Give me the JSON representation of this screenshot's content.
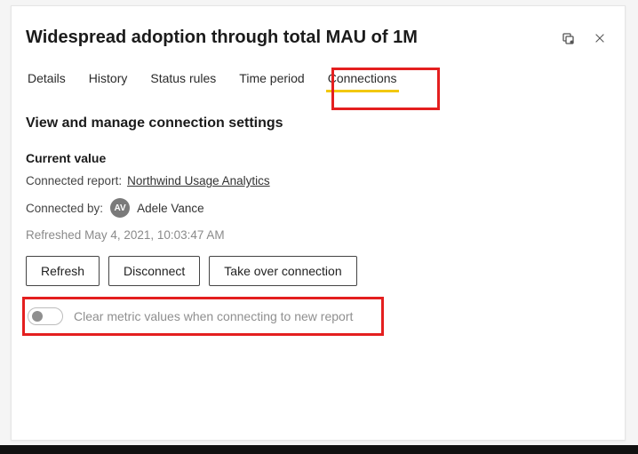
{
  "header": {
    "title": "Widespread adoption through total MAU of 1M"
  },
  "tabs": {
    "items": [
      {
        "label": "Details"
      },
      {
        "label": "History"
      },
      {
        "label": "Status rules"
      },
      {
        "label": "Time period"
      },
      {
        "label": "Connections"
      }
    ]
  },
  "section": {
    "title": "View and manage connection settings",
    "currentValueTitle": "Current value",
    "connectedReportLabel": "Connected report:",
    "connectedReportName": "Northwind Usage Analytics",
    "connectedByLabel": "Connected by:",
    "connectedByInitials": "AV",
    "connectedByName": "Adele Vance",
    "refreshedPrefix": "Refreshed",
    "refreshedValue": "May 4, 2021, 10:03:47 AM"
  },
  "buttons": {
    "refresh": "Refresh",
    "disconnect": "Disconnect",
    "takeOver": "Take over connection"
  },
  "toggle": {
    "label": "Clear metric values when connecting to new report"
  }
}
